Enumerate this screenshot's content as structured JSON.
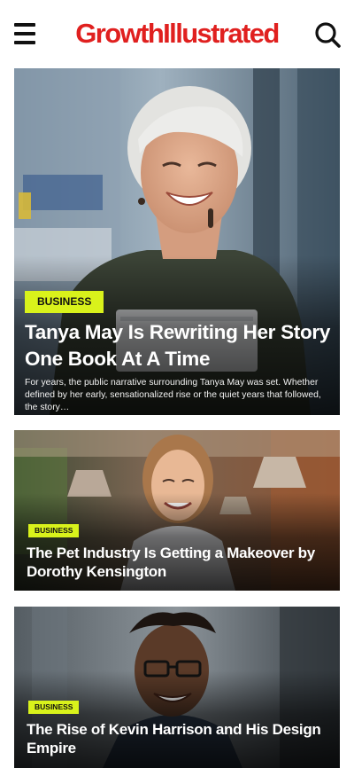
{
  "header": {
    "brand": "GrowthIllustrated",
    "brand_color": "#e0201f",
    "menu_icon": "hamburger-menu-icon",
    "search_icon": "search-icon"
  },
  "accent_color": "#d9f21b",
  "articles": [
    {
      "category": "BUSINESS",
      "title": "Tanya May Is Rewriting Her Story One Book At A Time",
      "excerpt": "For years, the public narrative surrounding Tanya May was set. Whether defined by her early, sensationalized rise or the quiet years that followed, the story…"
    },
    {
      "category": "BUSINESS",
      "title": "The Pet Industry Is Getting a Makeover by Dorothy Kensington"
    },
    {
      "category": "BUSINESS",
      "title": "The Rise of Kevin Harrison and His Design Empire"
    }
  ]
}
